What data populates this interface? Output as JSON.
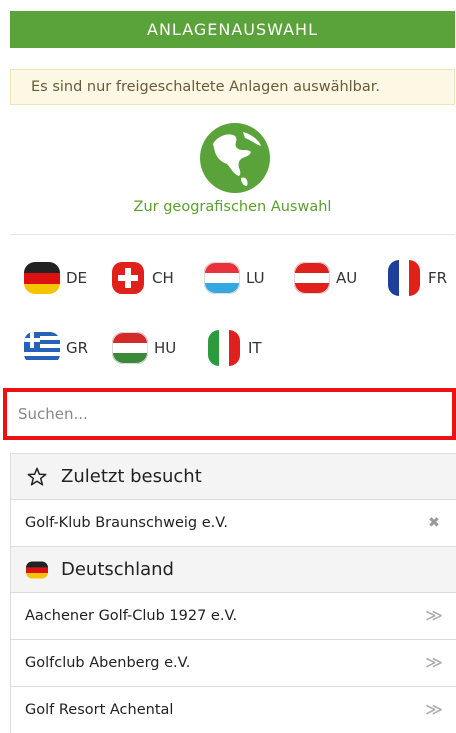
{
  "header": {
    "title": "ANLAGENAUSWAHL"
  },
  "notice": {
    "text": "Es sind nur freigeschaltete Anlagen auswählbar."
  },
  "geo": {
    "label": "Zur geografischen Auswahl"
  },
  "countries": [
    {
      "code": "DE"
    },
    {
      "code": "CH"
    },
    {
      "code": "LU"
    },
    {
      "code": "AU"
    },
    {
      "code": "FR"
    },
    {
      "code": "GR"
    },
    {
      "code": "HU"
    },
    {
      "code": "IT"
    }
  ],
  "search": {
    "placeholder": "Suchen...",
    "value": ""
  },
  "recent": {
    "title": "Zuletzt besucht",
    "items": [
      {
        "name": "Golf-Klub Braunschweig e.V.",
        "action": "✖"
      }
    ]
  },
  "germany": {
    "title": "Deutschland",
    "items": [
      {
        "name": "Aachener Golf-Club 1927 e.V.",
        "action": "≫"
      },
      {
        "name": "Golfclub Abenberg e.V.",
        "action": "≫"
      },
      {
        "name": "Golf Resort Achental",
        "action": "≫"
      }
    ]
  },
  "colors": {
    "accent": "#5aa23a",
    "link": "#5a9e2f",
    "highlight": "#ee1111"
  }
}
